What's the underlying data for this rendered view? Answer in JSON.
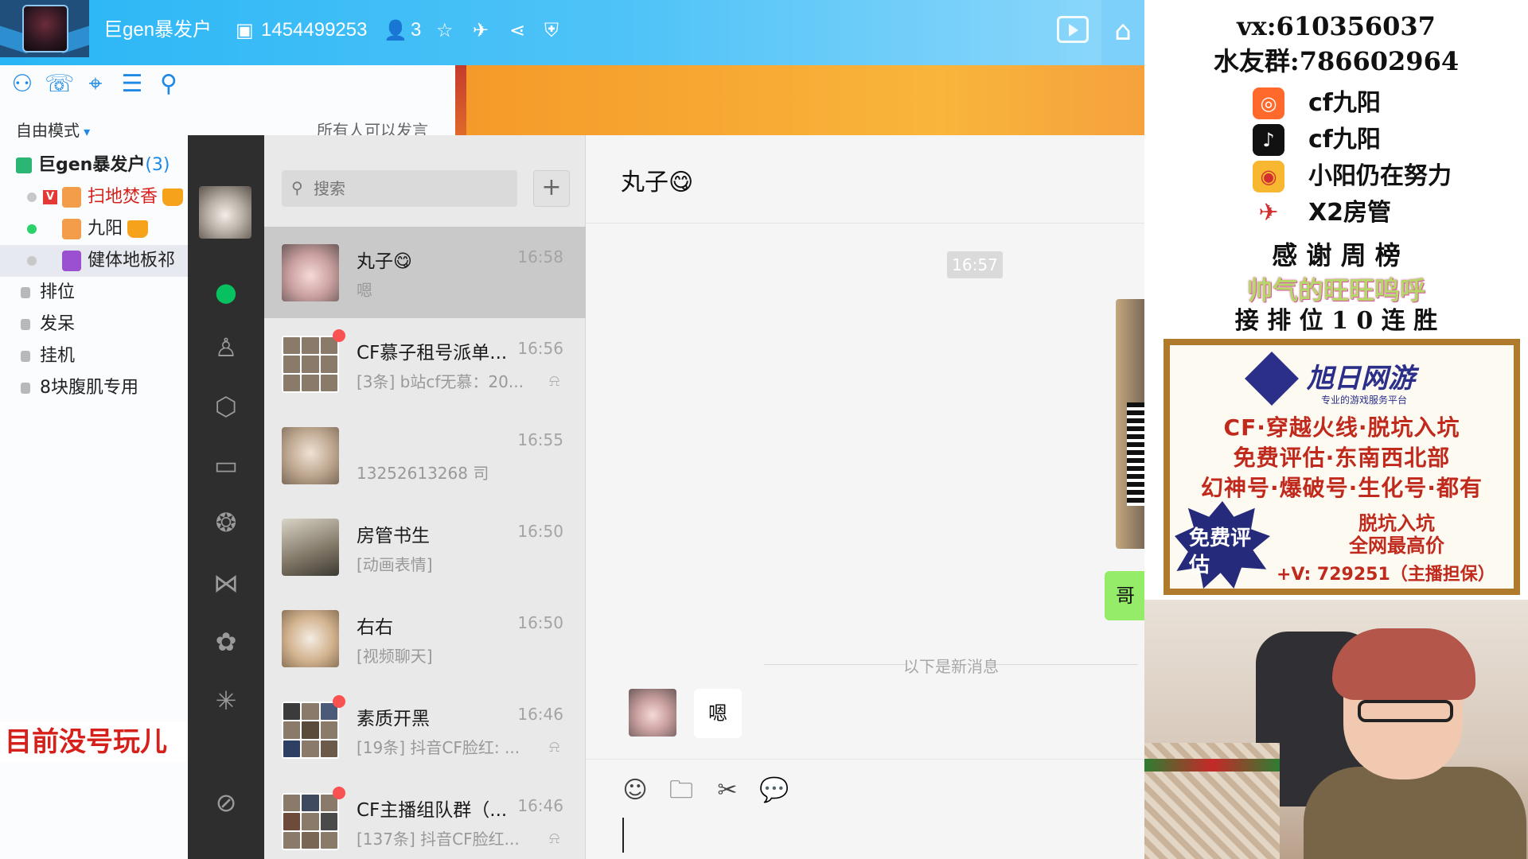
{
  "yy": {
    "channel_name": "巨gen暴发户",
    "channel_id": "1454499253",
    "online_count": "3",
    "tools": [
      "user-icon",
      "message-icon",
      "location-icon",
      "list-icon",
      "search-icon"
    ],
    "mode": "自由模式",
    "speak_permission": "所有人可以发言",
    "tree": {
      "root_name": "巨gen暴发户",
      "root_count": "(3)",
      "users": [
        "扫地焚香",
        "九阳",
        "健体地板祁"
      ],
      "channels": [
        "排位",
        "发呆",
        "挂机",
        "8块腹肌专用"
      ]
    },
    "overlay_note": "目前没号玩儿"
  },
  "wechat": {
    "search_placeholder": "搜索",
    "add_label": "+",
    "conversations": [
      {
        "name": "丸子😋",
        "time": "16:58",
        "preview": "嗯"
      },
      {
        "name": "CF慕子租号派单...",
        "time": "16:56",
        "preview": "[3条] b站cf无慕：20..."
      },
      {
        "name": "",
        "time": "16:55",
        "preview": "13252613268 司"
      },
      {
        "name": "房管书生",
        "time": "16:50",
        "preview": "[动画表情]"
      },
      {
        "name": "右右",
        "time": "16:50",
        "preview": "[视频聊天]"
      },
      {
        "name": "素质开黑",
        "time": "16:46",
        "preview": "[19条] 抖音CF脸红: ..."
      },
      {
        "name": "CF主播组队群（...",
        "time": "16:46",
        "preview": "[137条] 抖音CF脸红..."
      }
    ],
    "chat": {
      "title": "丸子😋",
      "timestamp": "16:57",
      "outgoing_text": "哥",
      "new_messages_label": "以下是新消息",
      "incoming_text": "嗯"
    },
    "composer_tools": [
      "emoji-icon",
      "folder-icon",
      "scissors-icon",
      "chat-bubble-icon"
    ]
  },
  "overlay": {
    "vx": "vx:610356037",
    "group": "水友群:786602964",
    "socials": [
      {
        "icon": "kuaishou-icon",
        "text": "cf九阳",
        "color": "#ff6a2c"
      },
      {
        "icon": "douyin-icon",
        "text": "cf九阳",
        "color": "#111111"
      },
      {
        "icon": "weibo-icon",
        "text": "小阳仍在努力",
        "color": "#f7b731"
      },
      {
        "icon": "plane-icon",
        "text": "X2房管",
        "color": "#d32f2f"
      }
    ],
    "thanks_title": "感 谢 周 榜",
    "thanks_name": "帅气的旺旺鸣呼",
    "challenge": "接 排 位 1 0 连 胜",
    "ad": {
      "brand": "旭日网游",
      "tagline": "专业的游戏服务平台",
      "line1": "CF·穿越火线·脱坑入坑",
      "line2": "免费评估·东南西北部",
      "line3": "幻神号·爆破号·生化号·都有",
      "burst": "免费评估",
      "red1": "脱坑入坑",
      "red2": "全网最高价",
      "contact": "+V: 729251（主播担保）"
    }
  }
}
